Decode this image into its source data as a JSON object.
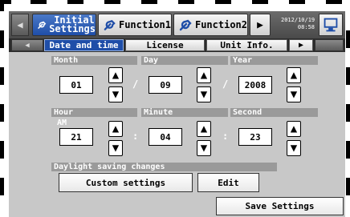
{
  "header": {
    "tabs": [
      {
        "label_line1": "Initial",
        "label_line2": "Settings",
        "active": true
      },
      {
        "label": "Function1",
        "active": false
      },
      {
        "label": "Function2",
        "active": false
      }
    ],
    "date": "2012/10/19",
    "time": "08:58"
  },
  "subtabs": [
    {
      "label": "Date and time",
      "active": true
    },
    {
      "label": "License",
      "active": false
    },
    {
      "label": "Unit Info.",
      "active": false
    }
  ],
  "date": {
    "month_label": "Month",
    "month": "01",
    "day_label": "Day",
    "day": "09",
    "year_label": "Year",
    "year": "2008",
    "separator": "/"
  },
  "time": {
    "hour_label": "Hour",
    "ampm": "AM",
    "hour": "21",
    "minute_label": "Minute",
    "minute": "04",
    "second_label": "Second",
    "second": "23",
    "separator": ":"
  },
  "dst": {
    "label": "Daylight saving changes",
    "custom_button": "Custom settings",
    "edit_button": "Edit"
  },
  "footer": {
    "save_button": "Save Settings"
  },
  "colors": {
    "accent": "#1f4ea8",
    "panel": "#c8c8c8",
    "label_bg": "#9a9a9a"
  }
}
